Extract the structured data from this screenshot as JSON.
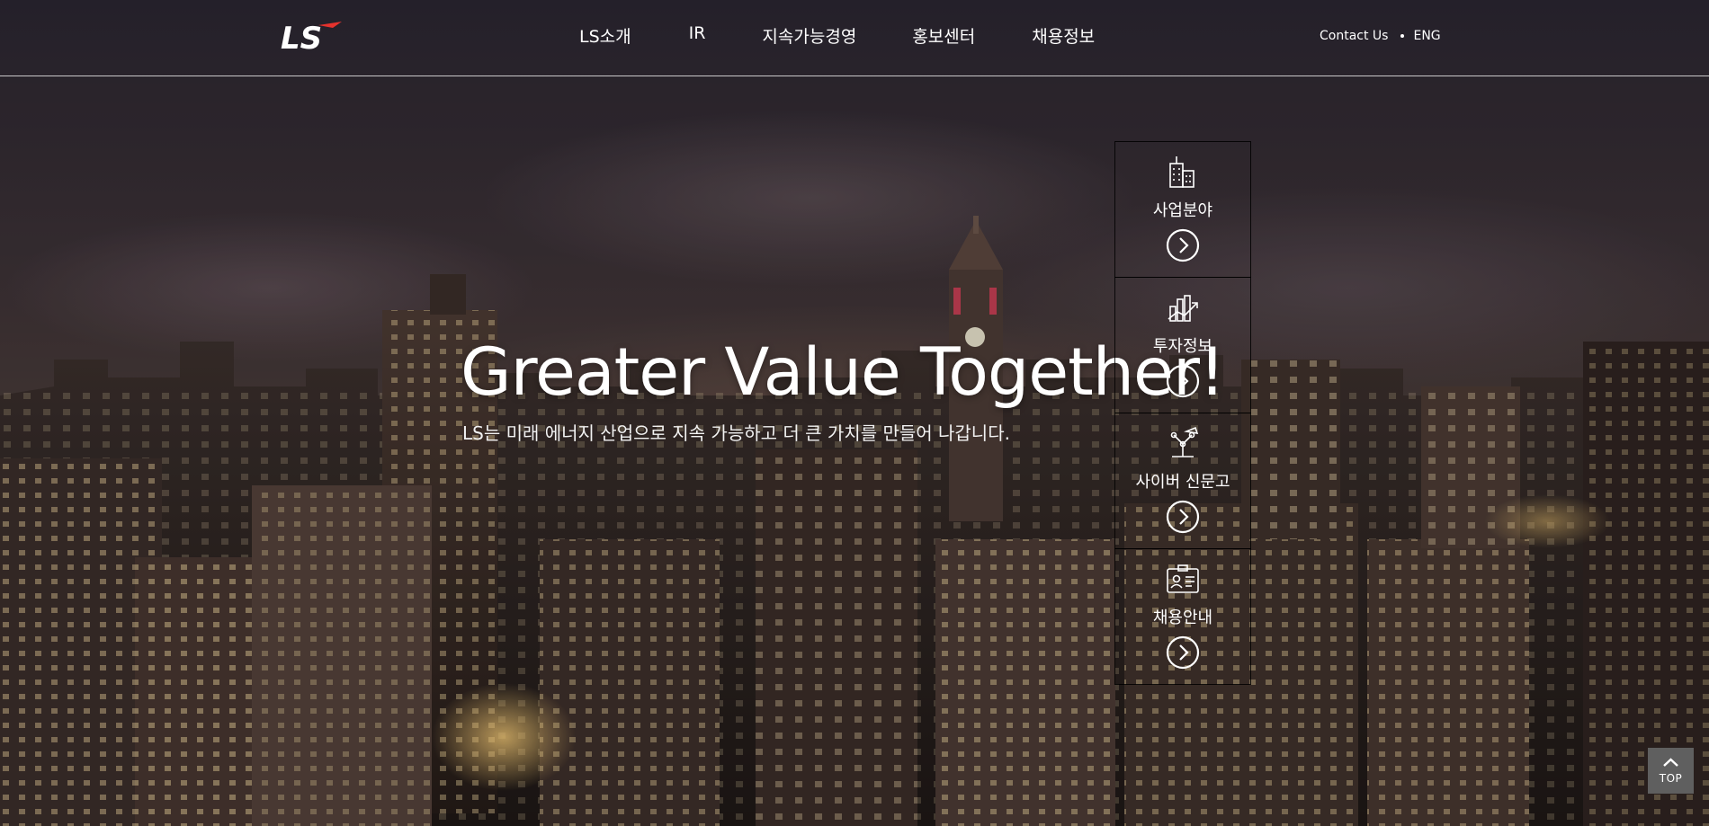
{
  "header": {
    "logo_text": "LS",
    "nav": [
      {
        "label": "LS소개"
      },
      {
        "label": "IR"
      },
      {
        "label": "지속가능경영"
      },
      {
        "label": "홍보센터"
      },
      {
        "label": "채용정보"
      }
    ],
    "util": {
      "contact": "Contact Us",
      "lang": "ENG"
    }
  },
  "hero": {
    "title": "Greater Value Together!",
    "subtitle": "LS는 미래 에너지 산업으로 지속 가능하고 더 큰 가치를 만들어 나갑니다."
  },
  "quick_menu": [
    {
      "label": "사업분야",
      "icon": "building-icon"
    },
    {
      "label": "투자정보",
      "icon": "chart-icon"
    },
    {
      "label": "사이버 신문고",
      "icon": "lamp-icon"
    },
    {
      "label": "채용안내",
      "icon": "id-card-icon"
    }
  ],
  "top_button": {
    "label": "TOP"
  },
  "colors": {
    "logo_accent": "#e5322d",
    "text": "#ffffff",
    "top_button_bg": "#5f5f5f"
  }
}
